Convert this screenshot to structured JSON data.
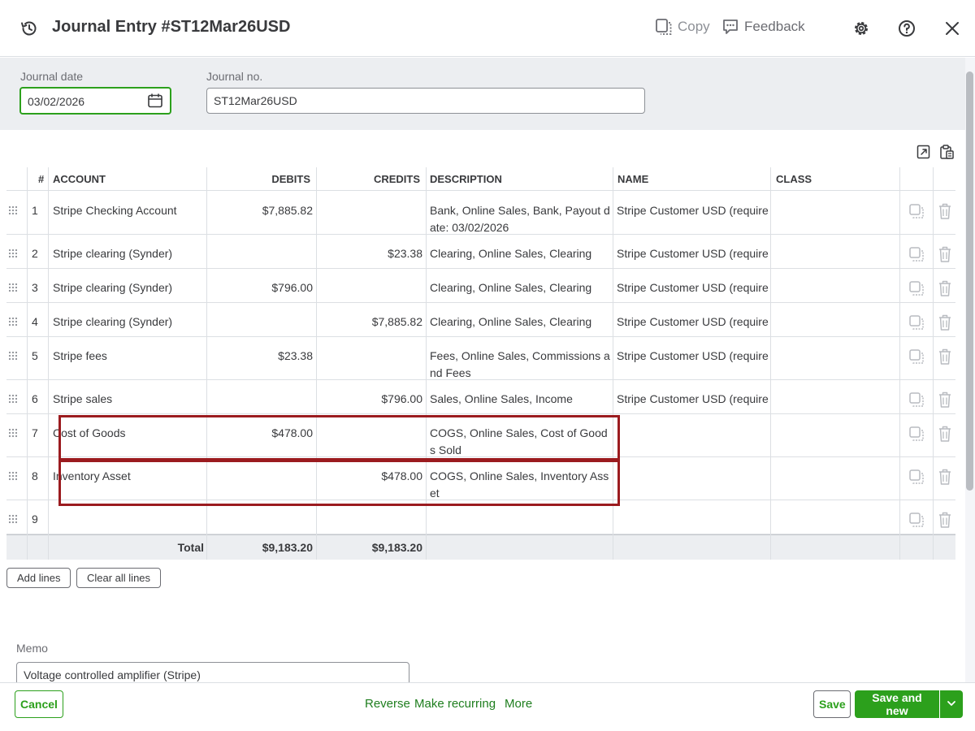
{
  "header": {
    "title": "Journal Entry #ST12Mar26USD",
    "copy_label": "Copy",
    "feedback_label": "Feedback"
  },
  "form": {
    "date_label": "Journal date",
    "date_value": "03/02/2026",
    "journal_no_label": "Journal no.",
    "journal_no_value": "ST12Mar26USD"
  },
  "table": {
    "headers": {
      "num": "#",
      "account": "ACCOUNT",
      "debits": "DEBITS",
      "credits": "CREDITS",
      "description": "DESCRIPTION",
      "name": "NAME",
      "class": "CLASS"
    },
    "rows": [
      {
        "num": "1",
        "account": "Stripe Checking Account",
        "debit": "$7,885.82",
        "credit": "",
        "description": "Bank, Online Sales, Bank, Payout date: 03/02/2026",
        "name": "Stripe Customer USD (require",
        "class": ""
      },
      {
        "num": "2",
        "account": "Stripe clearing (Synder)",
        "debit": "",
        "credit": "$23.38",
        "description": "Clearing, Online Sales, Clearing",
        "name": "Stripe Customer USD (require",
        "class": ""
      },
      {
        "num": "3",
        "account": "Stripe clearing (Synder)",
        "debit": "$796.00",
        "credit": "",
        "description": "Clearing, Online Sales, Clearing",
        "name": "Stripe Customer USD (require",
        "class": ""
      },
      {
        "num": "4",
        "account": "Stripe clearing (Synder)",
        "debit": "",
        "credit": "$7,885.82",
        "description": "Clearing, Online Sales, Clearing",
        "name": "Stripe Customer USD (require",
        "class": ""
      },
      {
        "num": "5",
        "account": "Stripe fees",
        "debit": "$23.38",
        "credit": "",
        "description": "Fees, Online Sales, Commissions and Fees",
        "name": "Stripe Customer USD (require",
        "class": ""
      },
      {
        "num": "6",
        "account": "Stripe sales",
        "debit": "",
        "credit": "$796.00",
        "description": "Sales, Online Sales, Income",
        "name": "Stripe Customer USD (require",
        "class": ""
      },
      {
        "num": "7",
        "account": "Cost of Goods",
        "debit": "$478.00",
        "credit": "",
        "description": "COGS, Online Sales, Cost of Goods Sold",
        "name": "",
        "class": ""
      },
      {
        "num": "8",
        "account": "Inventory Asset",
        "debit": "",
        "credit": "$478.00",
        "description": "COGS, Online Sales, Inventory Asset",
        "name": "",
        "class": ""
      },
      {
        "num": "9",
        "account": "",
        "debit": "",
        "credit": "",
        "description": "",
        "name": "",
        "class": ""
      }
    ],
    "total_label": "Total",
    "total_debits": "$9,183.20",
    "total_credits": "$9,183.20"
  },
  "buttons": {
    "add_lines": "Add lines",
    "clear_all_lines": "Clear all lines"
  },
  "memo": {
    "label": "Memo",
    "value": "Voltage controlled amplifier (Stripe)"
  },
  "footer": {
    "cancel": "Cancel",
    "reverse": "Reverse",
    "make_recurring": "Make recurring",
    "more": "More",
    "save": "Save",
    "save_and_new": "Save and new"
  },
  "colors": {
    "brand_green": "#2ca01c",
    "highlight_red": "#9b1b1f"
  }
}
